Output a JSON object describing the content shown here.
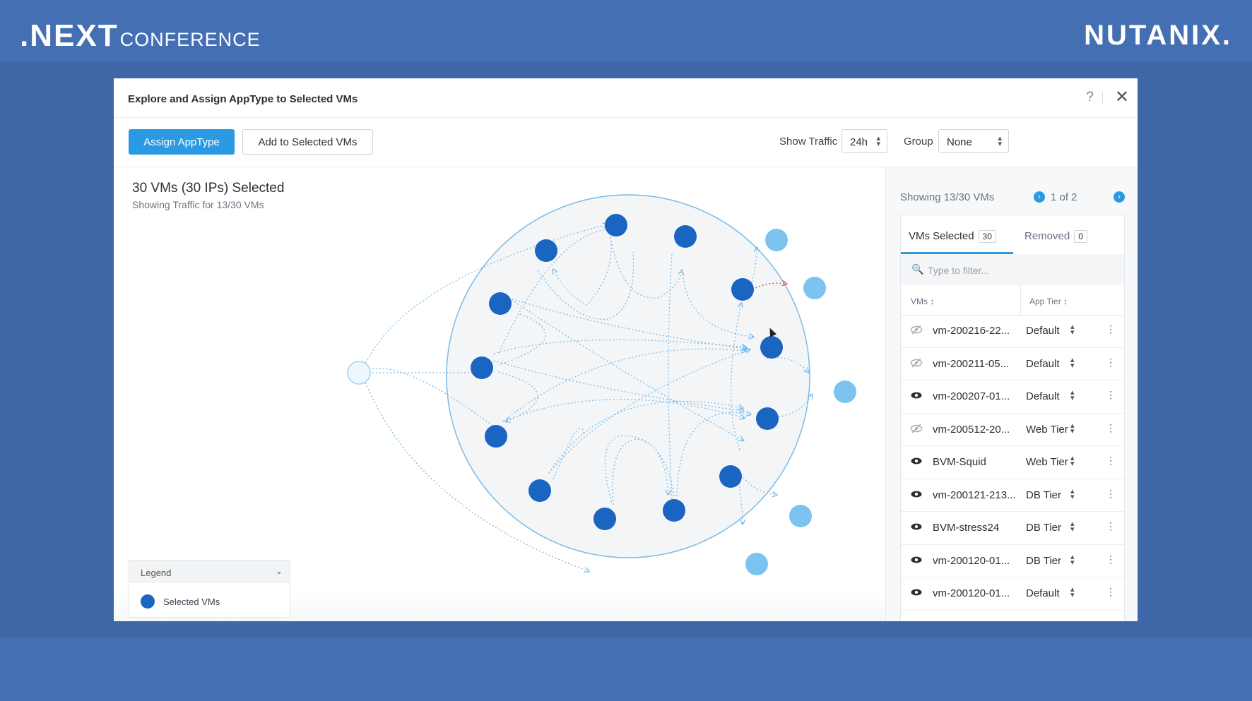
{
  "branding": {
    "left_primary": ".NEXT",
    "left_secondary": "CONFERENCE",
    "right": "NUTANIX."
  },
  "modal": {
    "title": "Explore and Assign AppType to Selected VMs",
    "help": "?",
    "close": "✕"
  },
  "toolbar": {
    "assign_label": "Assign AppType",
    "add_label": "Add to Selected VMs",
    "show_traffic_label": "Show Traffic",
    "show_traffic_value": "24h",
    "group_label": "Group",
    "group_value": "None"
  },
  "summary": {
    "title": "30 VMs (30 IPs) Selected",
    "subtitle": "Showing Traffic for 13/30 VMs"
  },
  "legend": {
    "header": "Legend",
    "items": [
      {
        "label": "Selected VMs",
        "color": "#1a64c2"
      }
    ]
  },
  "panel": {
    "showing": "Showing 13/30 VMs",
    "page": "1 of 2",
    "tabs": {
      "selected_label": "VMs Selected",
      "selected_count": "30",
      "removed_label": "Removed",
      "removed_count": "0"
    },
    "filter_placeholder": "Type to filter...",
    "columns": {
      "vms": "VMs ↕",
      "tier": "App Tier ↕"
    },
    "rows": [
      {
        "name": "vm-200216-22...",
        "tier": "Default",
        "visible": false
      },
      {
        "name": "vm-200211-05...",
        "tier": "Default",
        "visible": false
      },
      {
        "name": "vm-200207-01...",
        "tier": "Default",
        "visible": true
      },
      {
        "name": "vm-200512-20...",
        "tier": "Web Tier",
        "visible": false
      },
      {
        "name": "BVM-Squid",
        "tier": "Web Tier",
        "visible": true
      },
      {
        "name": "vm-200121-213...",
        "tier": "DB Tier",
        "visible": true
      },
      {
        "name": "BVM-stress24",
        "tier": "DB Tier",
        "visible": true
      },
      {
        "name": "vm-200120-01...",
        "tier": "DB Tier",
        "visible": true
      },
      {
        "name": "vm-200120-01...",
        "tier": "Default",
        "visible": true
      }
    ]
  },
  "colors": {
    "accent": "#2b9ae3",
    "selected_vm": "#1a64c2",
    "external_vm": "#7cc3f0",
    "page_bg": "#4470b3"
  }
}
